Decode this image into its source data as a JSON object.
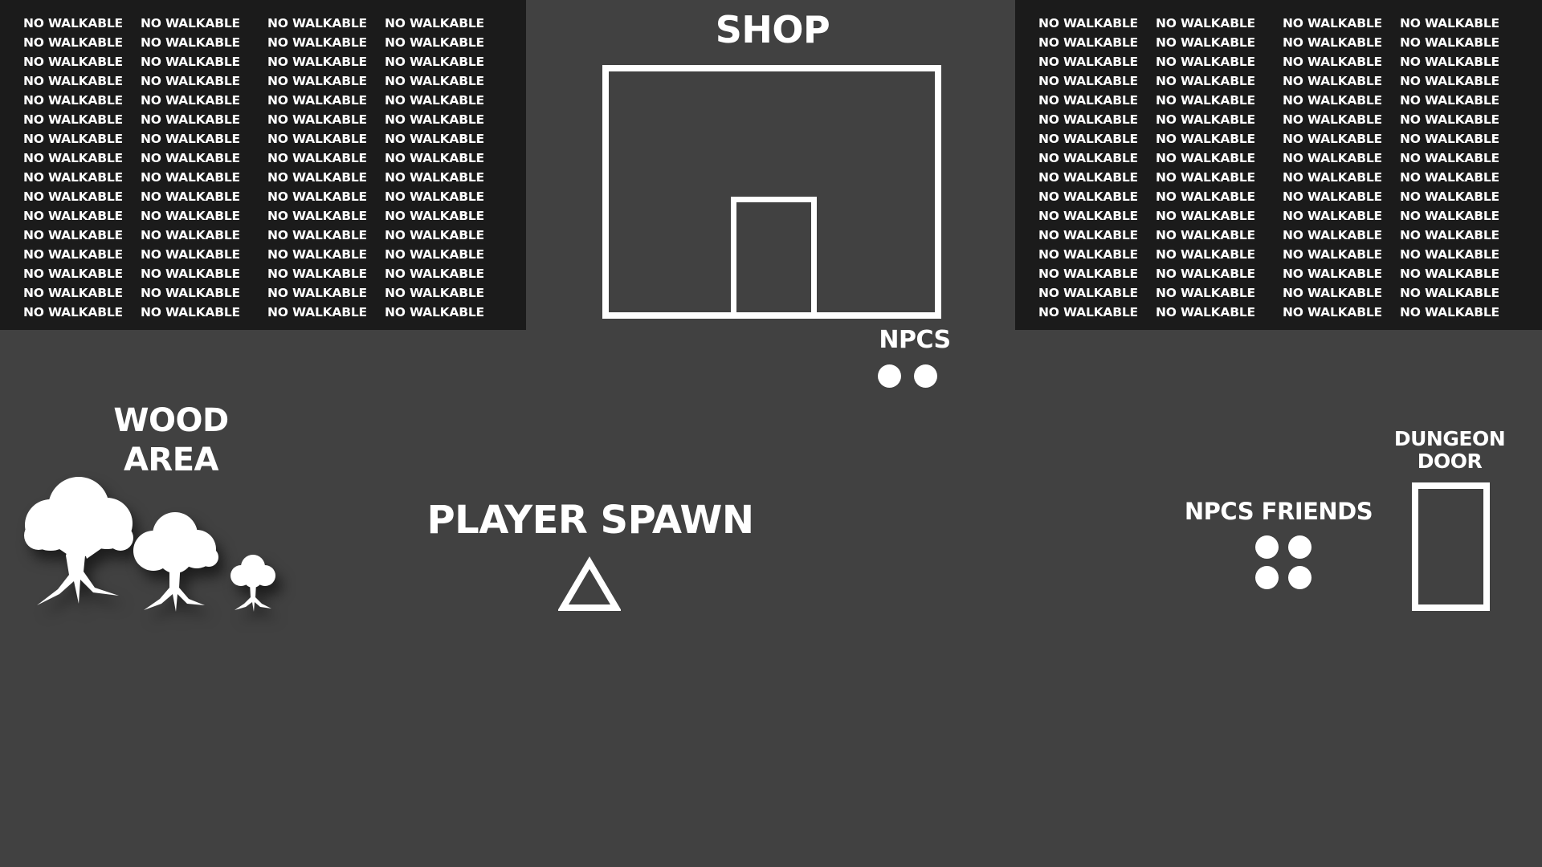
{
  "map": {
    "no_walkable_label": "NO WALKABLE",
    "shop_label": "SHOP",
    "npcs_label": "NPCS",
    "wood_area_line1": "WOOD",
    "wood_area_line2": "AREA",
    "player_spawn_label": "PLAYER SPAWN",
    "npcs_friends_label": "NPCS FRIENDS",
    "dungeon_door_line1": "DUNGEON",
    "dungeon_door_line2": "DOOR"
  },
  "colors": {
    "background": "#414141",
    "no_walkable_zone": "#1b1b1b",
    "foreground": "#ffffff"
  },
  "icons": {
    "player_spawn": "triangle-outline-icon",
    "npc": "circle-icon",
    "tree": "tree-icon",
    "door": "door-outline-icon"
  }
}
